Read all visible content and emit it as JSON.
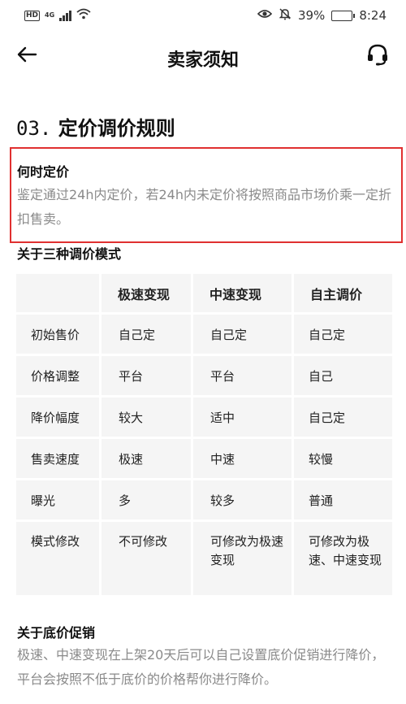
{
  "status_bar": {
    "hd": "HD",
    "network": "4G",
    "battery_percent": "39%",
    "battery_level": 0.39,
    "time": "8:24",
    "icons": [
      "eye-icon",
      "mute-bell-icon",
      "battery-icon",
      "wifi-icon",
      "signal-icon"
    ]
  },
  "nav": {
    "title": "卖家须知",
    "back_icon": "arrow-left-icon",
    "support_icon": "headset-icon"
  },
  "section": {
    "number": "03.",
    "title": "定价调价规则"
  },
  "when_to_price": {
    "heading": "何时定价",
    "text": "鉴定通过24h内定价，若24h内未定价将按照商品市场价乘一定折扣售卖。"
  },
  "modes": {
    "heading": "关于三种调价模式",
    "columns": [
      "",
      "极速变现",
      "中速变现",
      "自主调价"
    ],
    "rows": [
      {
        "label": "初始售价",
        "values": [
          "自己定",
          "自己定",
          "自己定"
        ]
      },
      {
        "label": "价格调整",
        "values": [
          "平台",
          "平台",
          "自己"
        ]
      },
      {
        "label": "降价幅度",
        "values": [
          "较大",
          "适中",
          "自己定"
        ]
      },
      {
        "label": "售卖速度",
        "values": [
          "极速",
          "中速",
          "较慢"
        ]
      },
      {
        "label": "曝光",
        "values": [
          "多",
          "较多",
          "普通"
        ]
      },
      {
        "label": "模式修改",
        "values": [
          "不可修改",
          "可修改为极速变现",
          "可修改为极速、中速变现"
        ]
      }
    ]
  },
  "floor_price": {
    "heading": "关于底价促销",
    "text": "极速、中速变现在上架20天后可以自己设置底价促销进行降价，平台会按照不低于底价的价格帮你进行降价。"
  },
  "colors": {
    "highlight_border": "#e03030",
    "table_cell_bg": "#f5f5f5",
    "muted_text": "#8a8a8a"
  }
}
